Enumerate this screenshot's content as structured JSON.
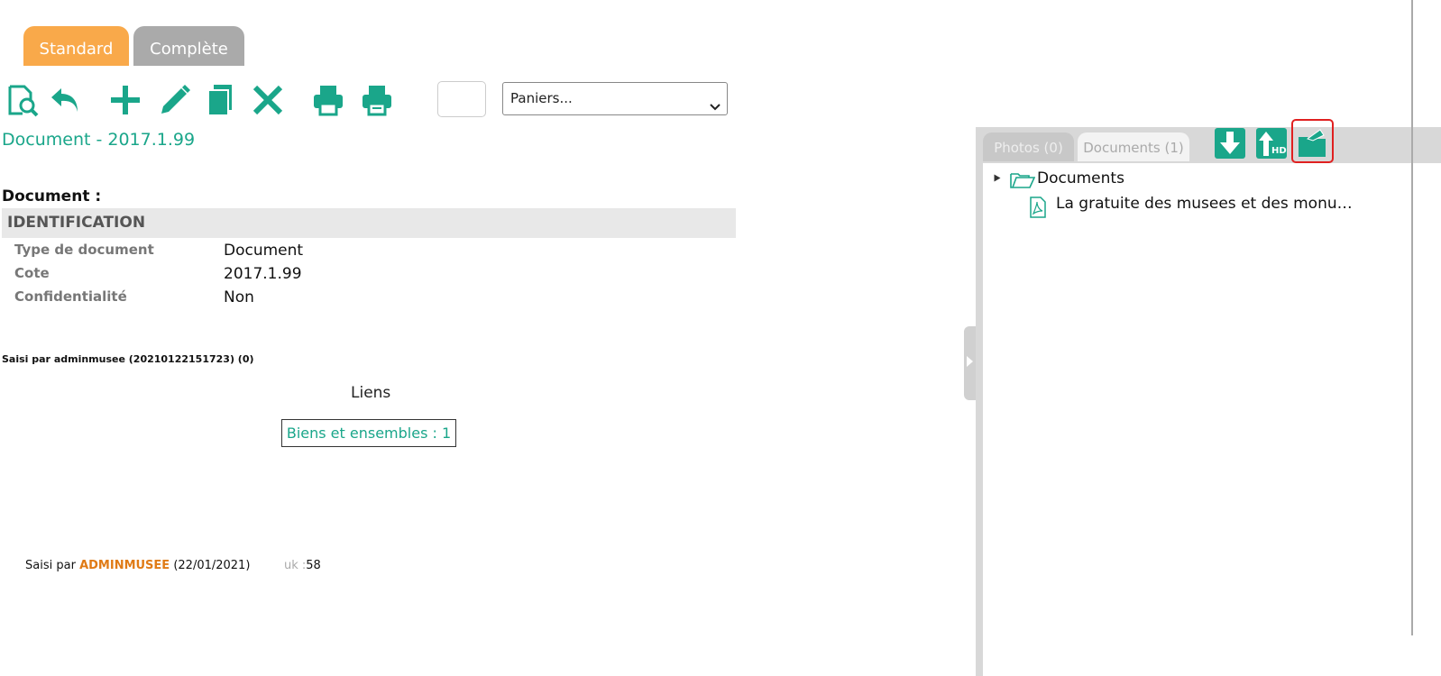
{
  "tabs": {
    "standard": "Standard",
    "complete": "Complète"
  },
  "toolbar": {
    "icons": [
      "search-document-icon",
      "undo-icon",
      "add-icon",
      "edit-icon",
      "duplicate-icon",
      "delete-icon",
      "print-icon",
      "print-list-icon"
    ],
    "basket_select": "Paniers..."
  },
  "document": {
    "title": "Document - 2017.1.99",
    "label": "Document :",
    "section": "IDENTIFICATION",
    "fields": [
      {
        "label": "Type de document",
        "value": "Document"
      },
      {
        "label": "Cote",
        "value": "2017.1.99"
      },
      {
        "label": "Confidentialité",
        "value": "Non"
      }
    ],
    "entered_by_line": "Saisi par adminmusee (20210122151723) (0)",
    "links_heading": "Liens",
    "links_button": "Biens et ensembles : 1"
  },
  "footer": {
    "saisi_prefix": "Saisi par",
    "user": "ADMINMUSEE",
    "date": "(22/01/2021)",
    "uk_label": "uk :",
    "uk_value": "58"
  },
  "panel": {
    "tabs": {
      "photos": "Photos (0)",
      "documents": "Documents (1)"
    },
    "tree": {
      "folder": "Documents",
      "file": "La gratuite des musees et des monu…"
    }
  },
  "colors": {
    "accent": "#1aa68a",
    "tab_active": "#f9a94a",
    "tab_inactive": "#aaaaaa",
    "user": "#e07b16",
    "highlight": "#e02020"
  }
}
